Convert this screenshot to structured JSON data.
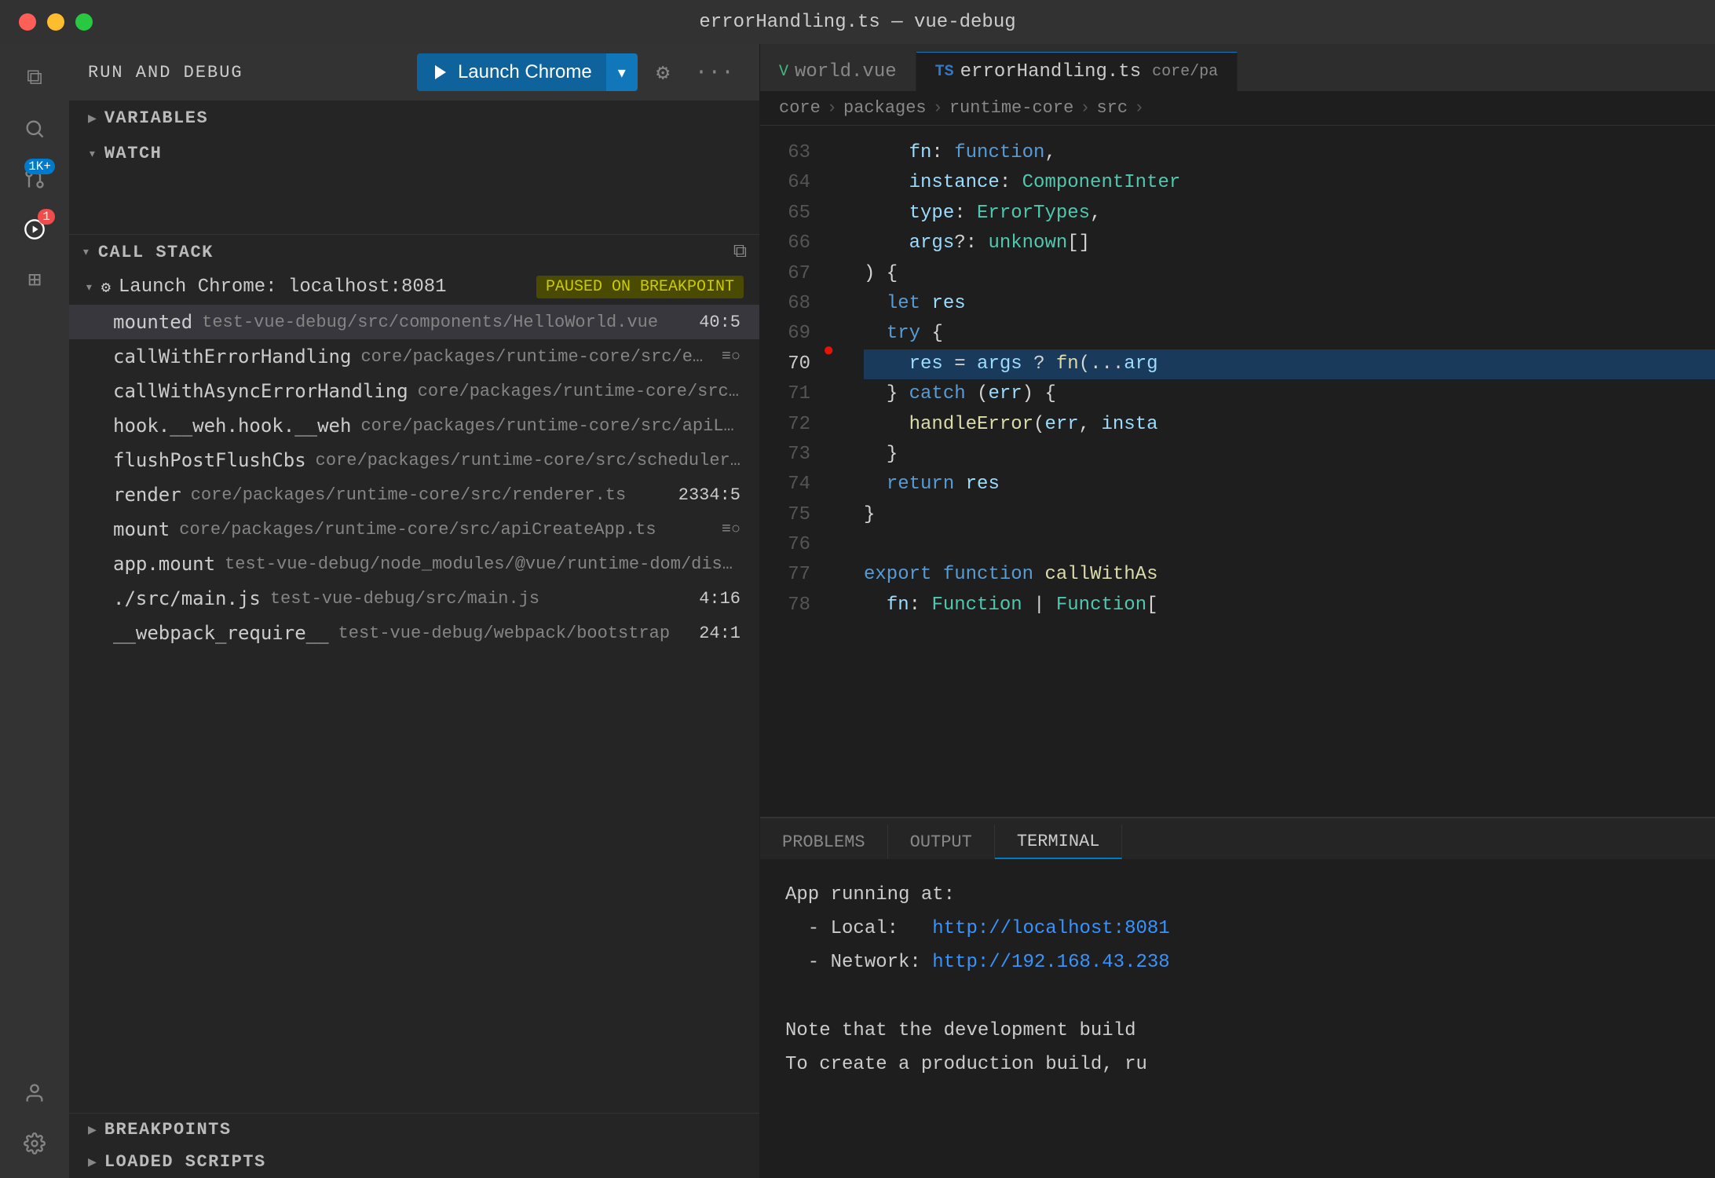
{
  "titlebar": {
    "title": "errorHandling.ts — vue-debug"
  },
  "activity": {
    "icons": [
      {
        "name": "explorer-icon",
        "symbol": "⧉",
        "active": false
      },
      {
        "name": "search-icon",
        "symbol": "🔍",
        "active": false
      },
      {
        "name": "source-control-icon",
        "symbol": "⑂",
        "active": false,
        "badge": "1K+"
      },
      {
        "name": "debug-icon",
        "symbol": "▶",
        "active": true,
        "badge1": "1"
      },
      {
        "name": "extensions-icon",
        "symbol": "⊞",
        "active": false
      }
    ],
    "bottom_icons": [
      {
        "name": "account-icon",
        "symbol": "👤"
      },
      {
        "name": "settings-icon",
        "symbol": "⚙"
      }
    ]
  },
  "sidebar": {
    "header": {
      "title": "RUN AND DEBUG",
      "launch_label": "Launch Chrome",
      "gear_label": "⚙",
      "more_label": "···"
    },
    "variables": {
      "title": "VARIABLES"
    },
    "watch": {
      "title": "WATCH"
    },
    "call_stack": {
      "title": "CALL STACK",
      "copy_icon": "⧉",
      "group": {
        "name": "Launch Chrome: localhost:8081",
        "badge": "PAUSED ON BREAKPOINT"
      },
      "items": [
        {
          "name": "mounted",
          "path": "test-vue-debug/src/components/HelloWorld.vue",
          "line": "40:5",
          "icon": null
        },
        {
          "name": "callWithErrorHandling",
          "path": "core/packages/runtime-core/src/error...",
          "icon": "≡○"
        },
        {
          "name": "callWithAsyncErrorHandling",
          "path": "core/packages/runtime-core/src/err...",
          "icon": null
        },
        {
          "name": "hook.__weh.hook.__weh",
          "path": "core/packages/runtime-core/src/apiLifec...",
          "icon": null
        },
        {
          "name": "flushPostFlushCbs",
          "path": "core/packages/runtime-core/src/scheduler.ts",
          "icon": null
        },
        {
          "name": "render",
          "path": "core/packages/runtime-core/src/renderer.ts",
          "line": "2334:5",
          "icon": null
        },
        {
          "name": "mount",
          "path": "core/packages/runtime-core/src/apiCreateApp.ts",
          "icon": "≡○"
        },
        {
          "name": "app.mount",
          "path": "test-vue-debug/node_modules/@vue/runtime-dom/dis...",
          "icon": null
        },
        {
          "name": "./src/main.js",
          "path": "test-vue-debug/src/main.js",
          "line": "4:16",
          "icon": null
        },
        {
          "name": "__webpack_require__",
          "path": "test-vue-debug/webpack/bootstrap",
          "line": "24:1",
          "icon": null
        }
      ]
    },
    "breakpoints": {
      "title": "BREAKPOINTS"
    },
    "loaded_scripts": {
      "title": "LOADED SCRIPTS"
    }
  },
  "editor": {
    "tabs": [
      {
        "label": "world.vue",
        "type": "vue",
        "active": false
      },
      {
        "label": "errorHandling.ts",
        "type": "ts",
        "path": "core/pa",
        "active": true
      }
    ],
    "breadcrumb": [
      "core",
      "packages",
      "runtime-core",
      "src"
    ],
    "lines": [
      {
        "num": 63,
        "content": "fn: function,"
      },
      {
        "num": 64,
        "content": "instance: ComponentInter"
      },
      {
        "num": 65,
        "content": "type: ErrorTypes,"
      },
      {
        "num": 66,
        "content": "args?: unknown[]"
      },
      {
        "num": 67,
        "content": ") {"
      },
      {
        "num": 68,
        "content": "  let res"
      },
      {
        "num": 69,
        "content": "  try {"
      },
      {
        "num": 70,
        "content": "    res = args ? fn(...arg",
        "active": true,
        "breakpoint": true
      },
      {
        "num": 71,
        "content": "  } catch (err) {"
      },
      {
        "num": 72,
        "content": "    handleError(err, insta"
      },
      {
        "num": 73,
        "content": "  }"
      },
      {
        "num": 74,
        "content": "  return res"
      },
      {
        "num": 75,
        "content": "}"
      },
      {
        "num": 76,
        "content": ""
      },
      {
        "num": 77,
        "content": "export function callWithAs"
      },
      {
        "num": 78,
        "content": "  fn: Function | Function["
      }
    ]
  },
  "bottom_panel": {
    "tabs": [
      {
        "label": "PROBLEMS",
        "active": false
      },
      {
        "label": "OUTPUT",
        "active": false
      },
      {
        "label": "TERMINAL",
        "active": true
      }
    ],
    "terminal": {
      "lines": [
        "App running at:",
        "  - Local:   http://localhost:8081",
        "  - Network: http://192.168.43.238",
        "",
        "Note that the development build",
        "To create a production build, ru"
      ],
      "local_url": "http://localhost:8081",
      "network_url": "http://192.168.43.238"
    }
  },
  "colors": {
    "accent": "#007acc",
    "debug_line": "#1a3a5c",
    "breakpoint": "#e51400"
  }
}
